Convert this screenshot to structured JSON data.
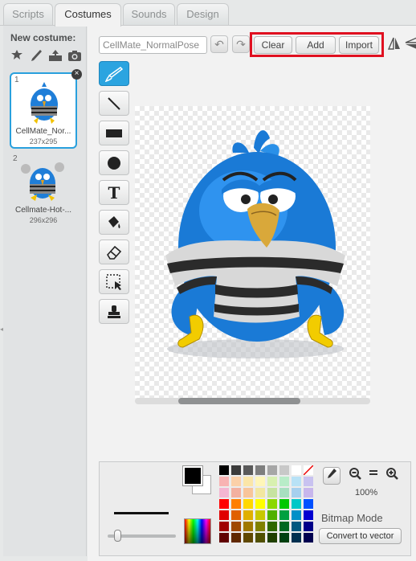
{
  "tabs": [
    "Scripts",
    "Costumes",
    "Sounds",
    "Design"
  ],
  "left_panel": {
    "new_costume_label": "New costume:",
    "costumes": [
      {
        "index": "1",
        "name": "CellMate_Nor...",
        "size": "237x295",
        "selected": true
      },
      {
        "index": "2",
        "name": "Cellmate-Hot-...",
        "size": "296x296",
        "selected": false
      }
    ]
  },
  "editor": {
    "costume_name_value": "CellMate_NormalPose",
    "clear_label": "Clear",
    "add_label": "Add",
    "import_label": "Import"
  },
  "bottom": {
    "zoom_level": "100%",
    "mode_label": "Bitmap Mode",
    "convert_label": "Convert to vector",
    "palette": [
      "#000000",
      "#3b3b3b",
      "#5a5a5a",
      "#7e7e7e",
      "#a6a6a6",
      "#c8c8c8",
      "#ffffff",
      "none",
      "#f8b3b3",
      "#fbd0a8",
      "#fbe6a8",
      "#fff6b8",
      "#d8f0b0",
      "#b8ecc8",
      "#b8e2f6",
      "#c8c2f0",
      "#f4b6d2",
      "#f3b0a0",
      "#f8c59a",
      "#f2e7a0",
      "#c7e3a0",
      "#a8dfc0",
      "#a6d0ee",
      "#c7b6ec",
      "#ff0000",
      "#ff7f00",
      "#ffd800",
      "#ffff00",
      "#8cd800",
      "#00c800",
      "#00c8c8",
      "#0050ff",
      "#e00000",
      "#e06000",
      "#e0b000",
      "#c8c800",
      "#50b000",
      "#00a040",
      "#0090c8",
      "#0000d0",
      "#a00000",
      "#a04800",
      "#a07800",
      "#808000",
      "#306800",
      "#006820",
      "#005880",
      "#000088",
      "#600000",
      "#602800",
      "#604800",
      "#505000",
      "#204000",
      "#004010",
      "#003050",
      "#000050"
    ]
  }
}
